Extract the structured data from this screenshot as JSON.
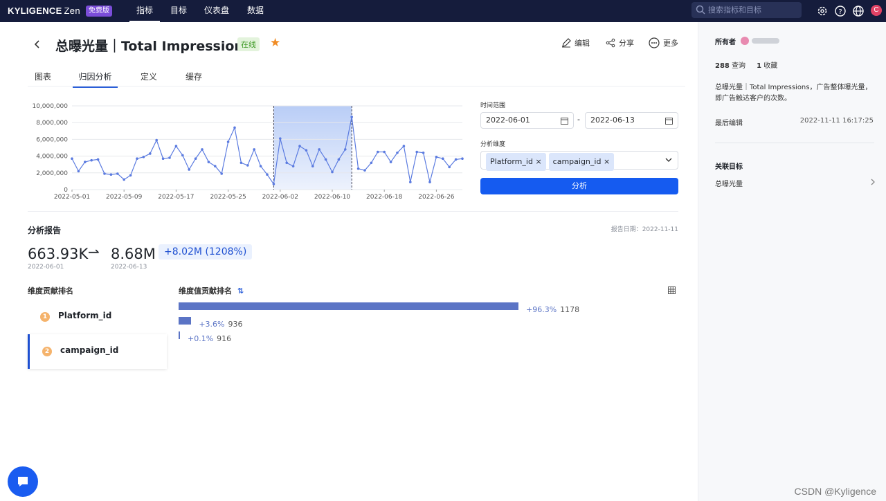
{
  "topbar": {
    "logo": "KYLIGENCE",
    "logo_zen": "Zen",
    "free_badge": "免费版",
    "nav": [
      "指标",
      "目标",
      "仪表盘",
      "数据"
    ],
    "search_placeholder": "搜索指标和目标",
    "avatar_letter": "C"
  },
  "header": {
    "title": "总曝光量｜Total Impressions",
    "status": "在线",
    "edit": "编辑",
    "share": "分享",
    "more": "更多"
  },
  "tabs": [
    "图表",
    "归因分析",
    "定义",
    "缓存"
  ],
  "selected_tab": "归因分析",
  "chart_data": {
    "type": "line",
    "x_tick_labels": [
      "2022-05-01",
      "2022-05-09",
      "2022-05-17",
      "2022-05-25",
      "2022-06-02",
      "2022-06-10",
      "2022-06-18",
      "2022-06-26"
    ],
    "y_tick_labels": [
      "0",
      "2,000,000",
      "4,000,000",
      "6,000,000",
      "8,000,000",
      "10,000,000"
    ],
    "ylim": [
      0,
      10000000
    ],
    "xlim": [
      "2022-05-01",
      "2022-06-30"
    ],
    "grid": true,
    "highlight_range": [
      "2022-06-01",
      "2022-06-13"
    ],
    "color": "#5b7be0",
    "x": [
      "2022-05-01",
      "2022-05-02",
      "2022-05-03",
      "2022-05-04",
      "2022-05-05",
      "2022-05-06",
      "2022-05-07",
      "2022-05-08",
      "2022-05-09",
      "2022-05-10",
      "2022-05-11",
      "2022-05-12",
      "2022-05-13",
      "2022-05-14",
      "2022-05-15",
      "2022-05-16",
      "2022-05-17",
      "2022-05-18",
      "2022-05-19",
      "2022-05-20",
      "2022-05-21",
      "2022-05-22",
      "2022-05-23",
      "2022-05-24",
      "2022-05-25",
      "2022-05-26",
      "2022-05-27",
      "2022-05-28",
      "2022-05-29",
      "2022-05-30",
      "2022-05-31",
      "2022-06-01",
      "2022-06-02",
      "2022-06-03",
      "2022-06-04",
      "2022-06-05",
      "2022-06-06",
      "2022-06-07",
      "2022-06-08",
      "2022-06-09",
      "2022-06-10",
      "2022-06-11",
      "2022-06-12",
      "2022-06-13",
      "2022-06-14",
      "2022-06-15",
      "2022-06-16",
      "2022-06-17",
      "2022-06-18",
      "2022-06-19",
      "2022-06-20",
      "2022-06-21",
      "2022-06-22",
      "2022-06-23",
      "2022-06-24",
      "2022-06-25",
      "2022-06-26",
      "2022-06-27",
      "2022-06-28",
      "2022-06-29",
      "2022-06-30"
    ],
    "values": [
      3700000,
      2200000,
      3300000,
      3500000,
      3600000,
      1900000,
      1800000,
      1900000,
      1200000,
      1700000,
      3700000,
      3900000,
      4300000,
      5900000,
      3700000,
      3800000,
      5200000,
      4100000,
      2400000,
      3700000,
      4800000,
      3300000,
      2800000,
      1900000,
      5700000,
      7400000,
      3200000,
      2900000,
      4800000,
      2800000,
      1800000,
      664000,
      6100000,
      3200000,
      2800000,
      5200000,
      4700000,
      2800000,
      4800000,
      3600000,
      2100000,
      3600000,
      4800000,
      8680000,
      2500000,
      2300000,
      3200000,
      4500000,
      4500000,
      3300000,
      4400000,
      5200000,
      900000,
      4500000,
      4400000,
      900000,
      3900000,
      3700000,
      2700000,
      3600000,
      3700000
    ]
  },
  "form": {
    "time_range_label": "时间范围",
    "start_date": "2022-06-01",
    "end_date": "2022-06-13",
    "dash": "-",
    "dimension_label": "分析维度",
    "dimension_tags": [
      "Platform_id",
      "campaign_id"
    ],
    "analyze_button": "分析"
  },
  "report": {
    "title": "分析报告",
    "report_date": "报告日期：2022-11-11",
    "start_value": "663.93K",
    "start_date": "2022-06-01",
    "arrow": "⇀",
    "end_value": "8.68M",
    "end_date": "2022-06-13",
    "delta": "+8.02M (1208%)",
    "dim_rank_title": "维度贡献排名",
    "dims": [
      {
        "rank": "1",
        "name": "Platform_id"
      },
      {
        "rank": "2",
        "name": "campaign_id"
      }
    ],
    "selected_dim": "campaign_id",
    "value_rank_title": "维度值贡献排名",
    "sort_icon": "⇅",
    "bars": [
      {
        "pct_value": 96.3,
        "pct": "+96.3%",
        "value": "1178"
      },
      {
        "pct_value": 3.6,
        "pct": "+3.6%",
        "value": "936"
      },
      {
        "pct_value": 0.1,
        "pct": "+0.1%",
        "value": "916"
      }
    ]
  },
  "sidebar": {
    "owner_label": "所有者",
    "queries_count": "288",
    "queries_label": "查询",
    "fav_count": "1",
    "fav_label": "收藏",
    "description": "总曝光量｜Total Impressions，广告整体曝光量，即广告触达客户的次数。",
    "last_edit_label": "最后编辑",
    "last_edit_value": "2022-11-11 16:17:25",
    "related_goal_title": "关联目标",
    "related_goal_item": "总曝光量"
  },
  "watermark": "CSDN @Kyligence"
}
